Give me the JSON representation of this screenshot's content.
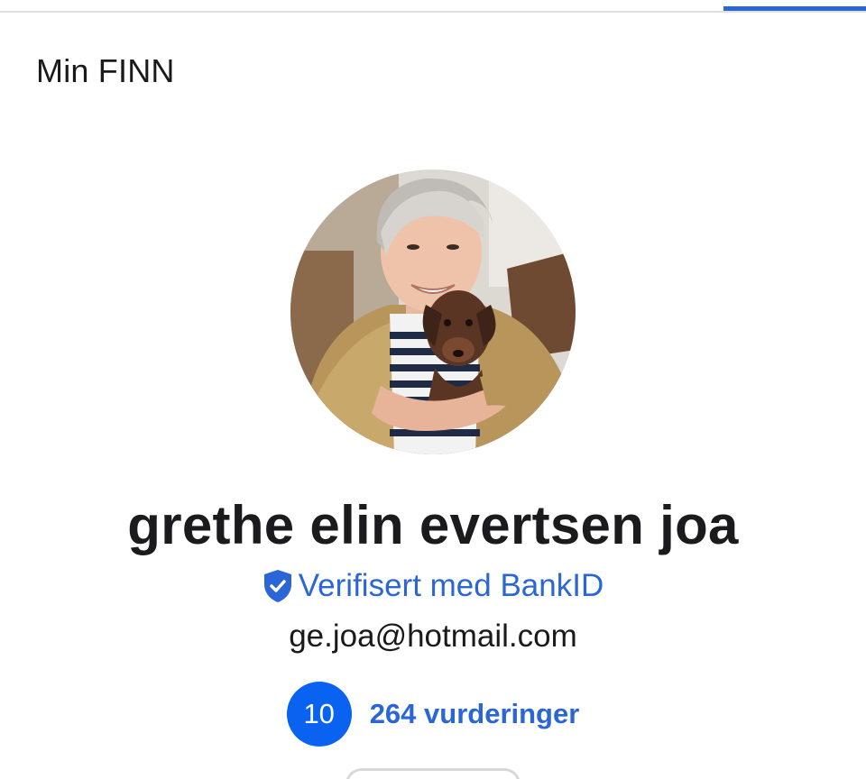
{
  "header": {
    "title": "Min FINN"
  },
  "profile": {
    "name": "grethe elin evertsen joa",
    "verified_label": "Verifisert med BankID",
    "email": "ge.joa@hotmail.com",
    "rating_score": "10",
    "reviews_label": "264 vurderinger"
  },
  "colors": {
    "accent": "#2a66d6",
    "badge": "#0a63f0",
    "text": "#1b1b1d"
  },
  "icons": {
    "verified": "shield-check-icon"
  }
}
